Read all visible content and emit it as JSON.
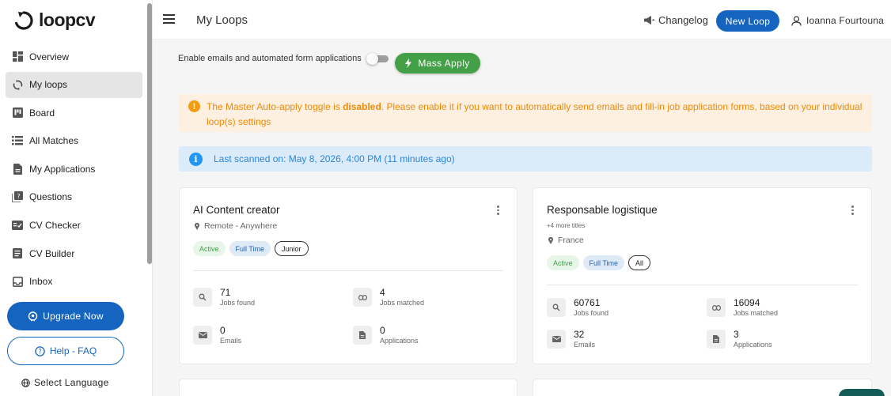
{
  "brand": {
    "name": "loopcv"
  },
  "sidebar": {
    "items": [
      {
        "label": "Overview",
        "icon": "dashboard-icon"
      },
      {
        "label": "My loops",
        "icon": "loop-icon",
        "active": true
      },
      {
        "label": "Board",
        "icon": "board-icon"
      },
      {
        "label": "All Matches",
        "icon": "list-icon"
      },
      {
        "label": "My Applications",
        "icon": "document-icon"
      },
      {
        "label": "Questions",
        "icon": "question-icon"
      },
      {
        "label": "CV Checker",
        "icon": "checker-icon"
      },
      {
        "label": "CV Builder",
        "icon": "builder-icon"
      },
      {
        "label": "Inbox",
        "icon": "inbox-icon"
      }
    ],
    "upgrade_label": "Upgrade Now",
    "help_label": "Help - FAQ",
    "language_label": "Select Language"
  },
  "header": {
    "title": "My Loops",
    "changelog_label": "Changelog",
    "new_loop_label": "New Loop",
    "user_name": "Ioanna Fourtouna"
  },
  "controls": {
    "toggle_label": "Enable emails and automated form applications",
    "toggle_on": false,
    "mass_apply_label": "Mass Apply"
  },
  "alerts": {
    "warning_prefix": "The Master Auto-apply toggle is ",
    "warning_bold": "disabled",
    "warning_suffix": ". Please enable it if you want to automatically send emails and fill-in job application forms, based on your individual loop(s) settings",
    "info_text": "Last scanned on: May 8, 2026, 4:00 PM (11 minutes ago)"
  },
  "loops": [
    {
      "title": "AI Content creator",
      "more_titles": "",
      "location": "Remote - Anywhere",
      "tags": [
        "Active",
        "Full Time",
        "Junior"
      ],
      "stats": {
        "jobs_found": {
          "value": "71",
          "label": "Jobs found"
        },
        "jobs_matched": {
          "value": "4",
          "label": "Jobs matched"
        },
        "emails": {
          "value": "0",
          "label": "Emails"
        },
        "applications": {
          "value": "0",
          "label": "Applications"
        }
      }
    },
    {
      "title": "Responsable logistique",
      "more_titles": "+4 more titles",
      "location": "France",
      "tags": [
        "Active",
        "Full Time",
        "All"
      ],
      "stats": {
        "jobs_found": {
          "value": "60761",
          "label": "Jobs found"
        },
        "jobs_matched": {
          "value": "16094",
          "label": "Jobs matched"
        },
        "emails": {
          "value": "32",
          "label": "Emails"
        },
        "applications": {
          "value": "3",
          "label": "Applications"
        }
      }
    }
  ],
  "colors": {
    "primary": "#1565c0",
    "success": "#43a047",
    "warning_bg": "#fdf0e1",
    "warning_text": "#ef8a07",
    "info_bg": "#dcebf9",
    "info_text": "#2a86d8"
  }
}
